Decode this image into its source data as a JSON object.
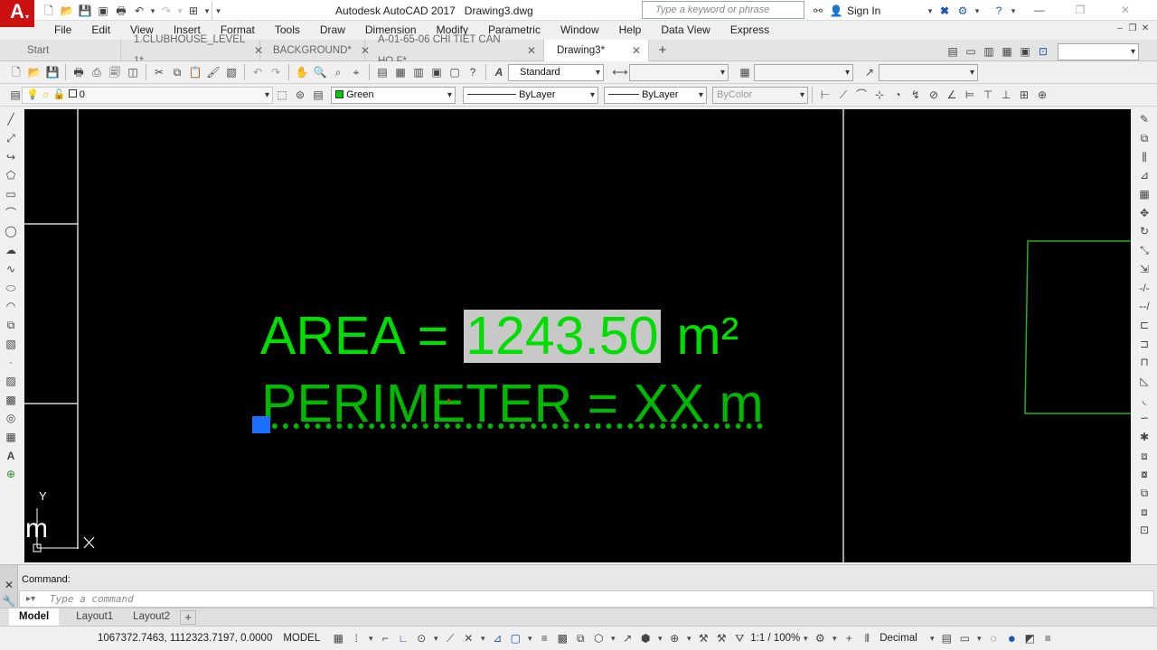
{
  "app": {
    "logo_letter": "A",
    "title": "Autodesk AutoCAD 2017",
    "document": "Drawing3.dwg",
    "search_placeholder": "Type a keyword or phrase",
    "signin_label": "Sign In"
  },
  "menu": [
    "File",
    "Edit",
    "View",
    "Insert",
    "Format",
    "Tools",
    "Draw",
    "Dimension",
    "Modify",
    "Parametric",
    "Window",
    "Help",
    "Data View",
    "Express"
  ],
  "tabs": [
    {
      "label": "Start",
      "closable": false,
      "active": false
    },
    {
      "label": "1.CLUBHOUSE_LEVEL 1*",
      "closable": true,
      "active": false
    },
    {
      "label": "BACKGROUND*",
      "closable": true,
      "active": false
    },
    {
      "label": "A-01-65-06 CHI TIET CAN HO F*",
      "closable": true,
      "active": false
    },
    {
      "label": "Drawing3*",
      "closable": true,
      "active": true
    }
  ],
  "new_tab_label": "+",
  "toolbar_text_style": "Standard",
  "layer": {
    "current": "0"
  },
  "properties": {
    "color": "Green",
    "linetype": "ByLayer",
    "lineweight": "ByLayer",
    "plotstyle": "ByColor"
  },
  "drawing": {
    "area_label": "AREA =",
    "area_value": "1243.50",
    "area_unit": "m²",
    "perimeter_text": "PERIMETER = XX m",
    "ucs_y": "Y",
    "ucs_fragment": "m",
    "colors": {
      "text": "#00dd00",
      "highlight": "#c8c8c8",
      "grip": "#1a6fff",
      "background": "#000000"
    }
  },
  "command": {
    "history": "Command:",
    "placeholder": "Type a command"
  },
  "layout_tabs": [
    {
      "label": "Model",
      "active": true
    },
    {
      "label": "Layout1",
      "active": false
    },
    {
      "label": "Layout2",
      "active": false
    }
  ],
  "status": {
    "coordinates": "1067372.7463, 1112323.7197, 0.0000",
    "space": "MODEL",
    "scale": "1:1 / 100%",
    "units": "Decimal"
  }
}
